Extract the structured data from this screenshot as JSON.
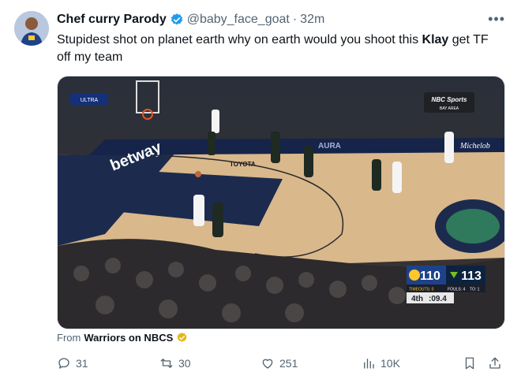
{
  "author": {
    "name": "Chef curry Parody",
    "handle": "@baby_face_goat",
    "separator": "·",
    "time": "32m"
  },
  "menu": {
    "more_label": "•••"
  },
  "tweet": {
    "text_before": "Stupidest shot on planet earth why on earth would you shoot this ",
    "text_bold": "Klay",
    "text_after": " get TF off my team"
  },
  "media": {
    "broadcaster_logo": "NBC Sports BAY AREA",
    "scoreboard": {
      "home_score": "110",
      "away_score": "113",
      "home_timeouts": "TIMEOUTS: 0",
      "away_fouls": "FOULS: 4",
      "away_to": "TO: 1",
      "period": "4th",
      "clock": ":09.4"
    },
    "court_text": [
      "betway",
      "TOYOTA",
      "Michelob",
      "AURA",
      "ULTRA"
    ]
  },
  "source": {
    "prefix": "From",
    "name": "Warriors on NBCS"
  },
  "actions": {
    "replies": "31",
    "retweets": "30",
    "likes": "251",
    "views": "10K"
  },
  "colors": {
    "verified": "#1d9bf0",
    "text": "#0f1419",
    "muted": "#536471",
    "gold_badge": "#e2b719"
  }
}
